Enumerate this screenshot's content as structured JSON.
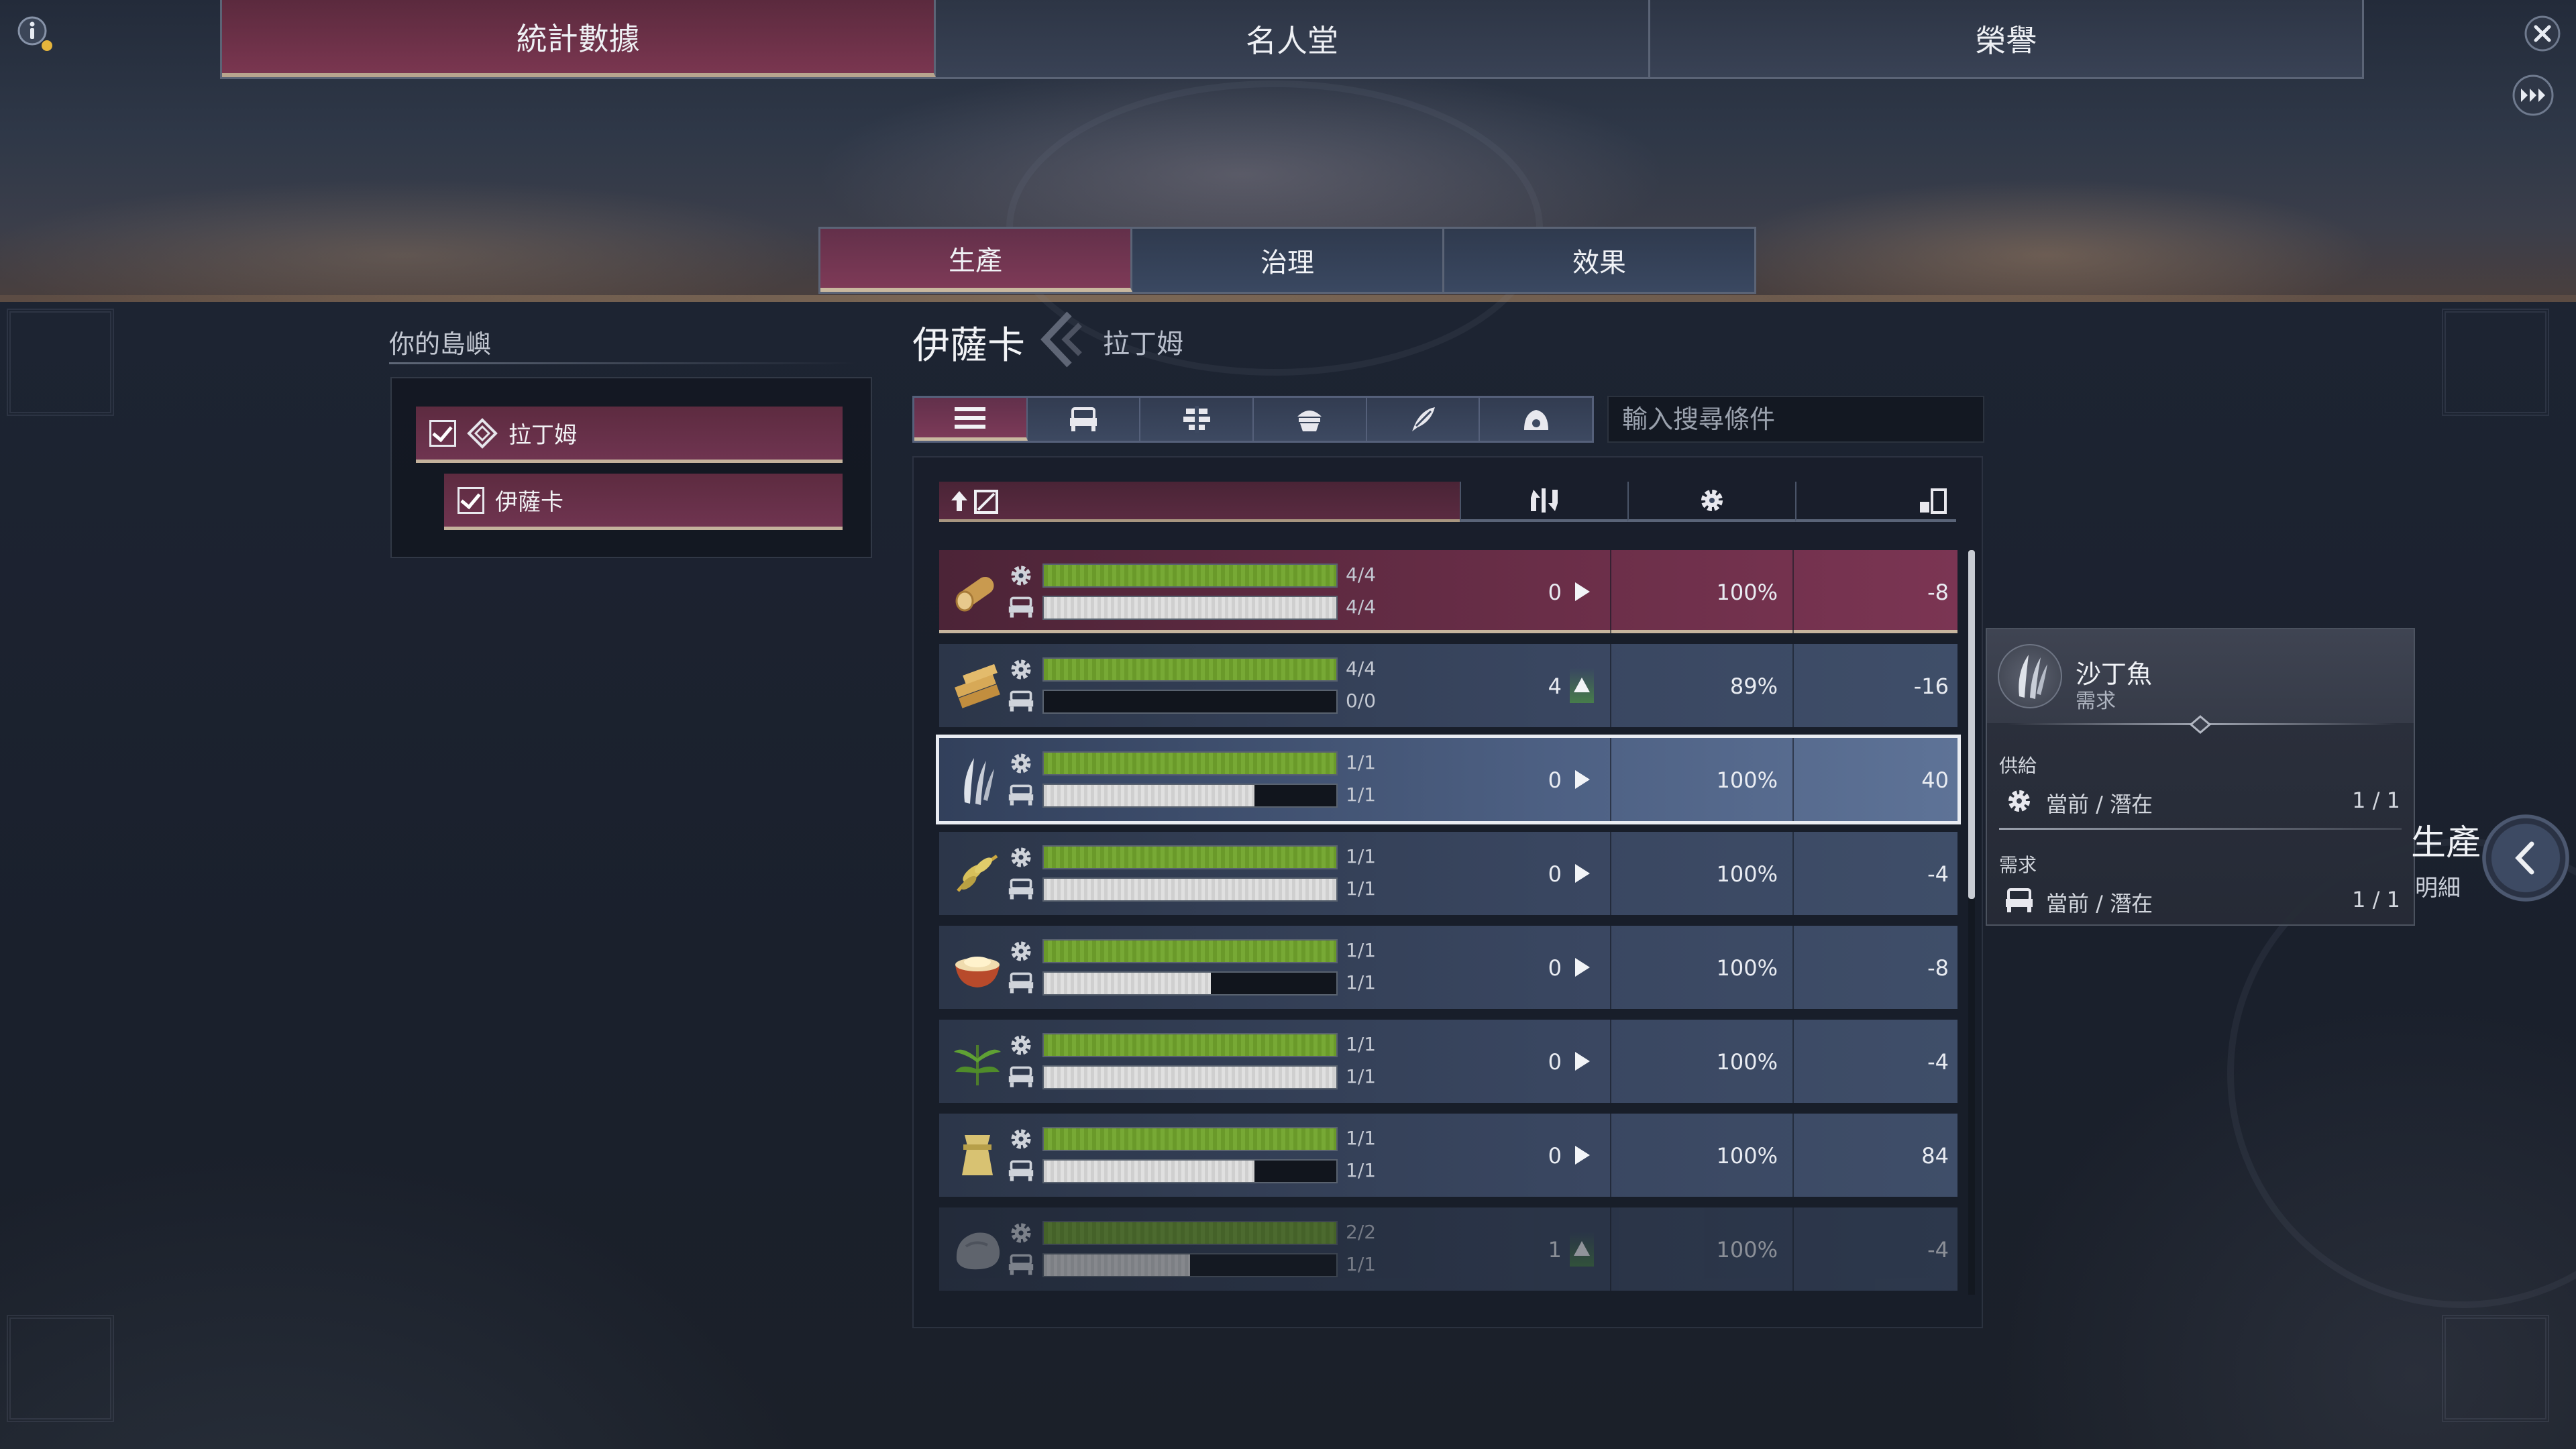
{
  "top_tabs": [
    {
      "label": "統計數據",
      "active": true
    },
    {
      "label": "名人堂",
      "active": false
    },
    {
      "label": "榮譽",
      "active": false
    }
  ],
  "sub_tabs": [
    {
      "label": "生產",
      "active": true
    },
    {
      "label": "治理",
      "active": false
    },
    {
      "label": "效果",
      "active": false
    }
  ],
  "islands_panel": {
    "title": "你的島嶼",
    "items": [
      {
        "label": "拉丁姆",
        "checked": true,
        "icon": "route-icon"
      },
      {
        "label": "伊薩卡",
        "checked": true
      }
    ]
  },
  "header": {
    "island": "伊薩卡",
    "sub_island": "拉丁姆"
  },
  "filters": {
    "icons": [
      "list-icon",
      "residence-icon",
      "infrastructure-icon",
      "food-icon",
      "feather-icon",
      "clay-icon"
    ],
    "active_index": 0
  },
  "search": {
    "placeholder": "輸入搜尋條件",
    "value": ""
  },
  "table": {
    "header_icons": [
      "sort-icon",
      "trend-icon",
      "production-icon",
      "balance-icon"
    ],
    "rows": [
      {
        "icon": "wood-log-icon",
        "supply_text": "4/4",
        "demand_text": "4/4",
        "supply_fill": 1.0,
        "demand_fill": 1.0,
        "trend": "0",
        "trend_dir": "right",
        "efficiency": "100%",
        "balance": "-8",
        "state": "selected"
      },
      {
        "icon": "planks-icon",
        "supply_text": "4/4",
        "demand_text": "0/0",
        "supply_fill": 1.0,
        "demand_fill": 0.0,
        "trend": "4",
        "trend_dir": "up",
        "efficiency": "89%",
        "balance": "-16",
        "state": "normal"
      },
      {
        "icon": "sardine-icon",
        "supply_text": "1/1",
        "demand_text": "1/1",
        "supply_fill": 1.0,
        "demand_fill": 0.72,
        "trend": "0",
        "trend_dir": "right",
        "efficiency": "100%",
        "balance": "40",
        "state": "highlighted"
      },
      {
        "icon": "grain-icon",
        "supply_text": "1/1",
        "demand_text": "1/1",
        "supply_fill": 1.0,
        "demand_fill": 1.0,
        "trend": "0",
        "trend_dir": "right",
        "efficiency": "100%",
        "balance": "-4",
        "state": "normal"
      },
      {
        "icon": "porridge-icon",
        "supply_text": "1/1",
        "demand_text": "1/1",
        "supply_fill": 1.0,
        "demand_fill": 0.57,
        "trend": "0",
        "trend_dir": "right",
        "efficiency": "100%",
        "balance": "-8",
        "state": "normal"
      },
      {
        "icon": "herb-icon",
        "supply_text": "1/1",
        "demand_text": "1/1",
        "supply_fill": 1.0,
        "demand_fill": 1.0,
        "trend": "0",
        "trend_dir": "right",
        "efficiency": "100%",
        "balance": "-4",
        "state": "normal"
      },
      {
        "icon": "linen-icon",
        "supply_text": "1/1",
        "demand_text": "1/1",
        "supply_fill": 1.0,
        "demand_fill": 0.72,
        "trend": "0",
        "trend_dir": "right",
        "efficiency": "100%",
        "balance": "84",
        "state": "normal"
      },
      {
        "icon": "stone-icon",
        "supply_text": "2/2",
        "demand_text": "1/1",
        "supply_fill": 1.0,
        "demand_fill": 0.5,
        "trend": "1",
        "trend_dir": "up",
        "efficiency": "100%",
        "balance": "-4",
        "state": "faded"
      }
    ]
  },
  "tooltip": {
    "title": "沙丁魚",
    "subtitle": "需求",
    "supply_section": "供給",
    "supply_label": "當前 / 潛在",
    "supply_value": "1 / 1",
    "demand_section": "需求",
    "demand_label": "當前 / 潛在",
    "demand_value": "1 / 1"
  },
  "side_panel": {
    "label_1": "生產",
    "label_2": "明細"
  },
  "colors": {
    "active_tab": "#7a3650",
    "bar_green": "#77a935",
    "bar_grey": "#e0e0e0"
  }
}
